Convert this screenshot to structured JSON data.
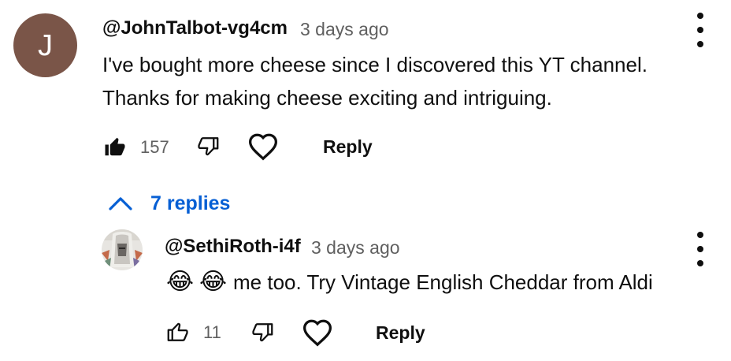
{
  "colors": {
    "avatar_bg": "#7a5548",
    "link_blue": "#065fd4",
    "text_primary": "#0f0f0f",
    "text_secondary": "#606060"
  },
  "comment": {
    "avatar_letter": "J",
    "author": "@JohnTalbot-vg4cm",
    "time": "3 days ago",
    "text_line1": "I've bought more cheese since I discovered this YT channel.",
    "text_line2": "Thanks for making cheese exciting and intriguing.",
    "like_count": "157",
    "like_icon": "thumbs-up-filled-icon",
    "dislike_icon": "thumbs-down-icon",
    "heart_icon": "heart-icon",
    "reply_label": "Reply",
    "menu_icon": "more-vert-icon"
  },
  "replies_toggle": {
    "icon": "chevron-up-icon",
    "label": "7 replies"
  },
  "reply": {
    "author": "@SethiRoth-i4f",
    "time": "3 days ago",
    "emoji_1": "😂",
    "emoji_2": "😂",
    "text": "me too. Try Vintage English Cheddar from Aldi",
    "like_count": "11",
    "like_icon": "thumbs-up-outline-icon",
    "dislike_icon": "thumbs-down-icon",
    "heart_icon": "heart-icon",
    "reply_label": "Reply",
    "menu_icon": "more-vert-icon"
  }
}
